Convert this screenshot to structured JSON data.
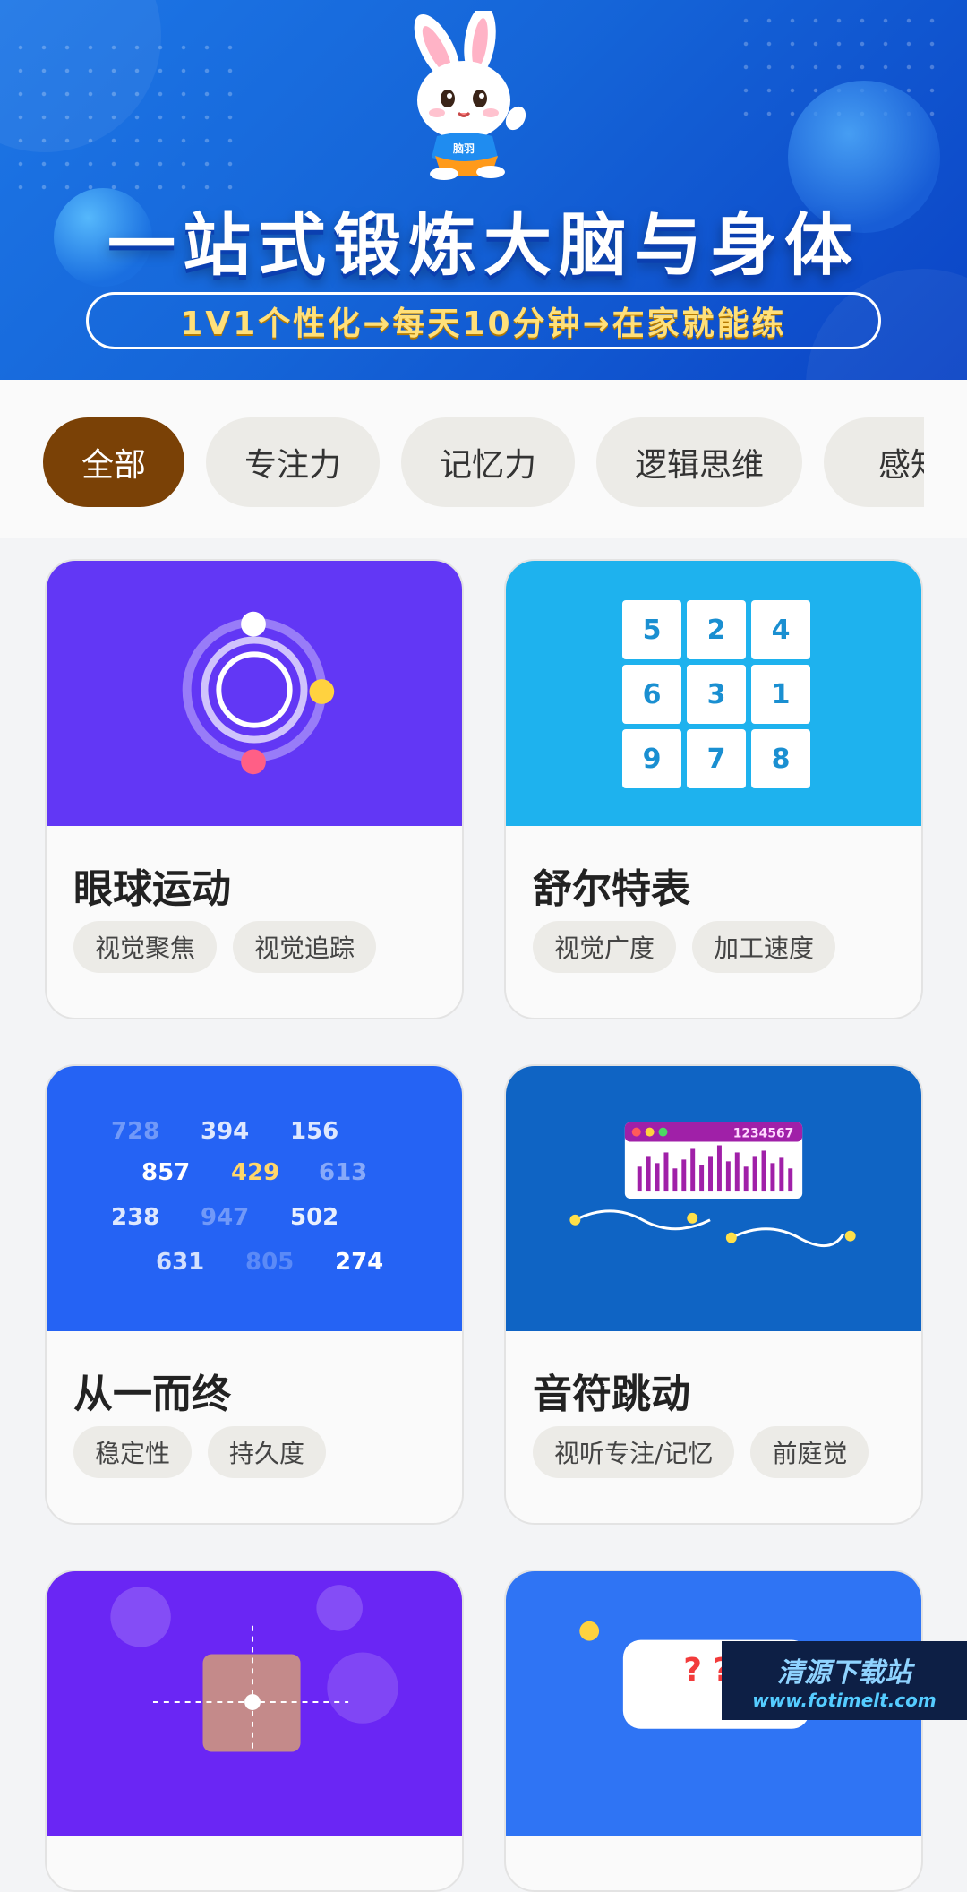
{
  "banner": {
    "title": "一站式锻炼大脑与身体",
    "subtitle": "1V1个性化→每天10分钟→在家就能练",
    "mascot_badge": "脑羽"
  },
  "tabs": [
    {
      "label": "全部",
      "active": true
    },
    {
      "label": "专注力",
      "active": false
    },
    {
      "label": "记忆力",
      "active": false
    },
    {
      "label": "逻辑思维",
      "active": false
    },
    {
      "label": "感知",
      "active": false
    }
  ],
  "cards": [
    {
      "title": "眼球运动",
      "tags": [
        "视觉聚焦",
        "视觉追踪"
      ],
      "art_color": "#6237f5"
    },
    {
      "title": "舒尔特表",
      "tags": [
        "视觉广度",
        "加工速度"
      ],
      "art_color": "#1eb2ee",
      "grid": [
        "5",
        "2",
        "4",
        "6",
        "3",
        "1",
        "9",
        "7",
        "8"
      ]
    },
    {
      "title": "从一而终",
      "tags": [
        "稳定性",
        "持久度"
      ],
      "art_color": "#2563f4",
      "numbers": [
        "728",
        "394",
        "156",
        "857",
        "429",
        "613",
        "238",
        "947",
        "502",
        "631",
        "805",
        "274"
      ]
    },
    {
      "title": "音符跳动",
      "tags": [
        "视听专注/记忆",
        "前庭觉"
      ],
      "art_color": "#0f64c4",
      "counter": "1234567"
    },
    {
      "title": "",
      "tags": [],
      "art_color": "#6a26f4"
    },
    {
      "title": "",
      "tags": [],
      "art_color": "#2f74f4",
      "marks": "? ?"
    }
  ],
  "watermark": {
    "name": "清源下载站",
    "url": "www.fotimelt.com"
  }
}
